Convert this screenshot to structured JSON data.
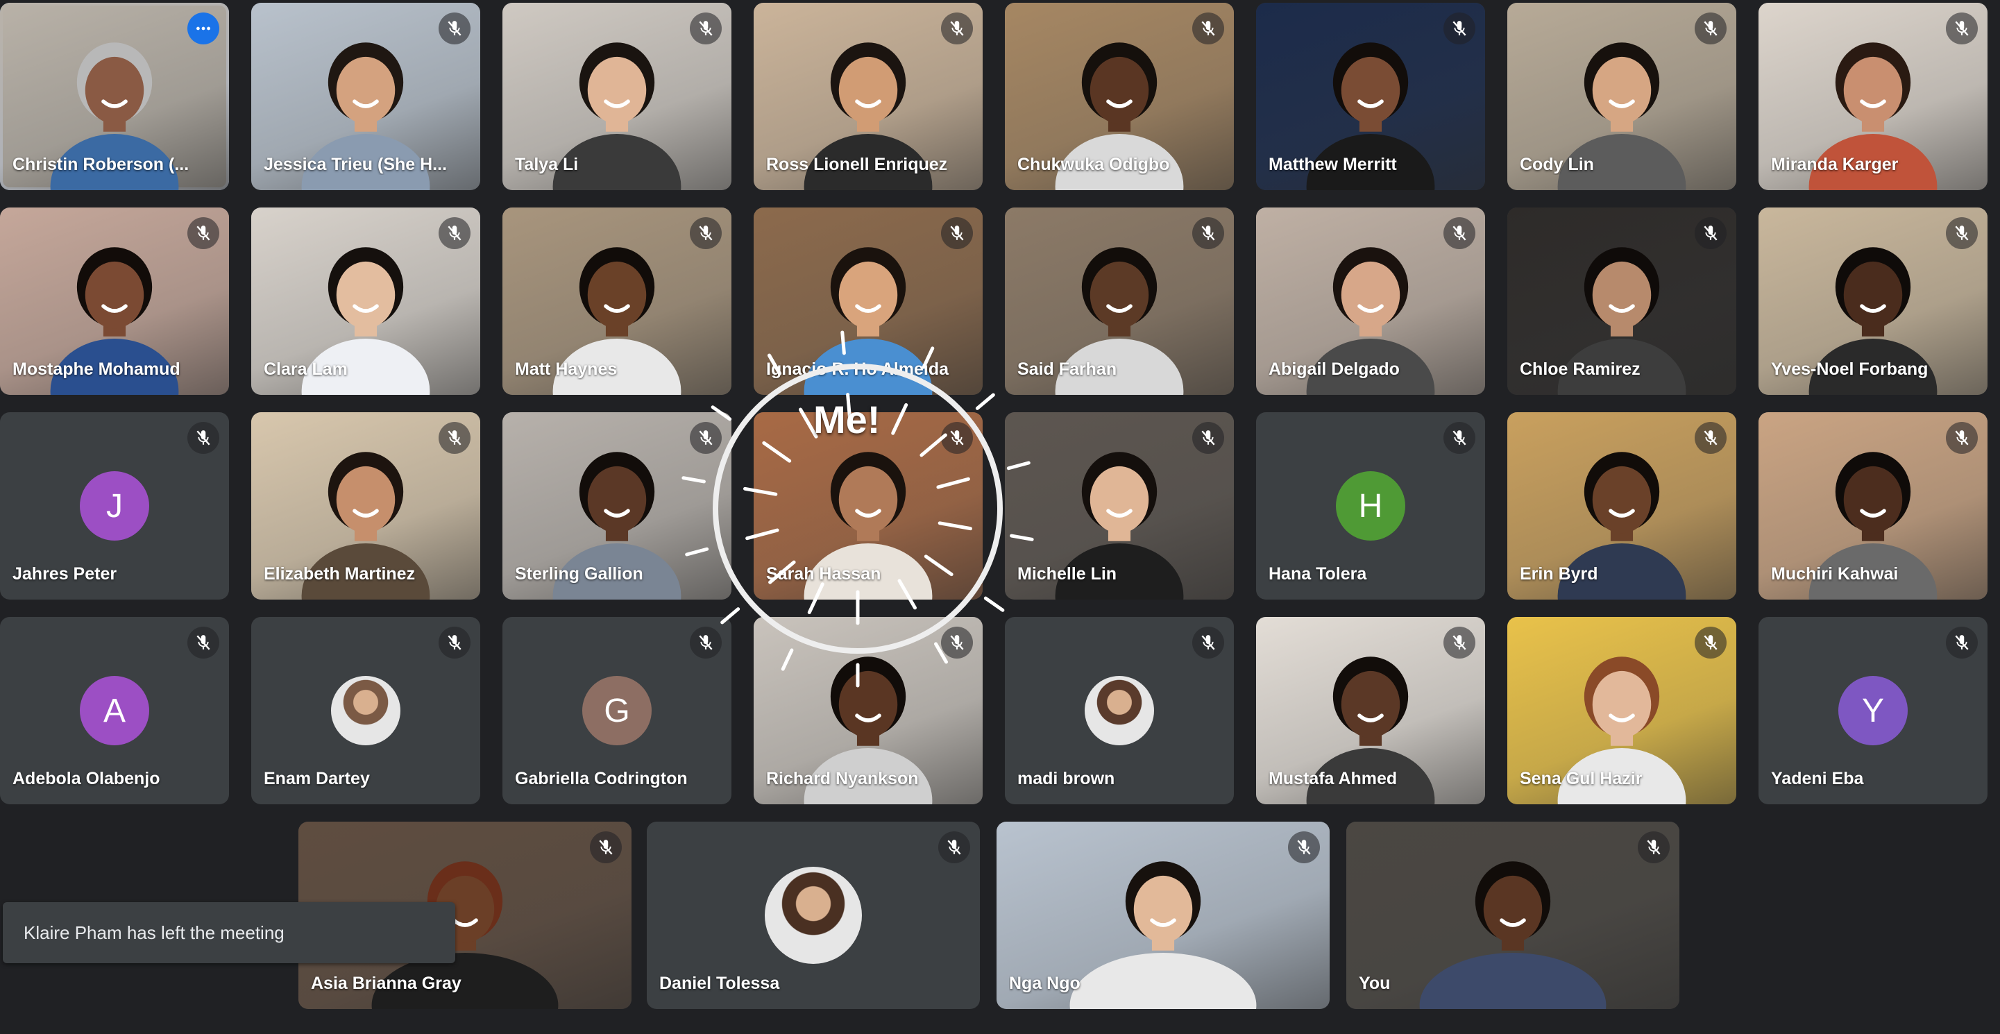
{
  "app": {
    "background": "#202124",
    "accent": "#1a73e8",
    "active_outline": "#8ab4f8"
  },
  "participants": [
    {
      "name": "Christin Roberson (...",
      "kind": "video",
      "bg": "#b9b2a8",
      "skin": "#8a5a44",
      "hair": "#b8b8b8",
      "shirt": "#3b6aa3",
      "muted": false,
      "pinned_menu": true
    },
    {
      "name": "Jessica Trieu (She H...",
      "kind": "video",
      "bg": "#b9c2cc",
      "skin": "#d4a27f",
      "hair": "#1f1712",
      "shirt": "#8a9bb0",
      "muted": true
    },
    {
      "name": "Talya Li",
      "kind": "video",
      "bg": "#cfc9c2",
      "skin": "#e0b596",
      "hair": "#1a1410",
      "shirt": "#3a3a3a",
      "muted": true
    },
    {
      "name": "Ross Lionell Enriquez",
      "kind": "video",
      "bg": "#cbb49a",
      "skin": "#d19c74",
      "hair": "#1b1410",
      "shirt": "#2b2b2b",
      "muted": true
    },
    {
      "name": "Chukwuka Odigbo",
      "kind": "video",
      "bg": "#a68763",
      "skin": "#5a3623",
      "hair": "#15100c",
      "shirt": "#d9d9d9",
      "muted": true
    },
    {
      "name": "Matthew Merritt",
      "kind": "video",
      "bg": "#1c2b4a",
      "skin": "#7a4c34",
      "hair": "#120d0a",
      "shirt": "#1a1a1a",
      "muted": true
    },
    {
      "name": "Cody Lin",
      "kind": "video",
      "bg": "#b7aa97",
      "skin": "#d6a683",
      "hair": "#17110d",
      "shirt": "#5c5c5c",
      "muted": true
    },
    {
      "name": "Miranda Karger",
      "kind": "video",
      "bg": "#ddd5cc",
      "skin": "#c98f70",
      "hair": "#2a1a12",
      "shirt": "#c0533a",
      "muted": true
    },
    {
      "name": "Mostaphe Mohamud",
      "kind": "video",
      "bg": "#c5a79a",
      "skin": "#7b4a33",
      "hair": "#120c09",
      "shirt": "#2a4f8f",
      "muted": true
    },
    {
      "name": "Clara Lam",
      "kind": "video",
      "bg": "#d8d2cb",
      "skin": "#e3bd9f",
      "hair": "#15100d",
      "shirt": "#eef0f4",
      "muted": true
    },
    {
      "name": "Matt Haynes",
      "kind": "video",
      "bg": "#a8957d",
      "skin": "#6a4128",
      "hair": "#110c09",
      "shirt": "#e8e8e8",
      "muted": true
    },
    {
      "name": "Ignacio R. Ho Almeida",
      "kind": "video",
      "bg": "#8c6a4c",
      "skin": "#d9a47c",
      "hair": "#1a120d",
      "shirt": "#4a8fd1",
      "muted": true
    },
    {
      "name": "Said Farhan",
      "kind": "video",
      "bg": "#8c7a67",
      "skin": "#5c3a26",
      "hair": "#120d0a",
      "shirt": "#d8d8d8",
      "muted": true
    },
    {
      "name": "Abigail Delgado",
      "kind": "video",
      "bg": "#bfb0a4",
      "skin": "#d7a789",
      "hair": "#1a120e",
      "shirt": "#4a4a4a",
      "muted": true
    },
    {
      "name": "Chloe Ramirez",
      "kind": "video",
      "bg": "#2e2b29",
      "skin": "#b78a6c",
      "hair": "#0f0b09",
      "shirt": "#3d3d3d",
      "muted": true
    },
    {
      "name": "Yves-Noel Forbang",
      "kind": "video",
      "bg": "#c9b79c",
      "skin": "#4a2c1d",
      "hair": "#0f0b09",
      "shirt": "#2a2a2a",
      "muted": true
    },
    {
      "name": "Jahres Peter",
      "kind": "avatar",
      "initial": "J",
      "avatar_color": "#9c4fc4",
      "muted": true
    },
    {
      "name": "Elizabeth Martinez",
      "kind": "video",
      "bg": "#d8c7ad",
      "skin": "#c68f6c",
      "hair": "#1d140f",
      "shirt": "#5a4a3a",
      "muted": true
    },
    {
      "name": "Sterling Gallion",
      "kind": "video",
      "bg": "#b7b1ab",
      "skin": "#5b3826",
      "hair": "#120d0a",
      "shirt": "#7a8594",
      "muted": true
    },
    {
      "name": "Sarah Hassan",
      "kind": "video",
      "bg": "#a86a45",
      "skin": "#b07a58",
      "hair": "#1a120d",
      "shirt": "#e8e2da",
      "muted": true
    },
    {
      "name": "Michelle Lin",
      "kind": "video",
      "bg": "#5d5650",
      "skin": "#e0b696",
      "hair": "#140f0c",
      "shirt": "#1e1e1e",
      "muted": true
    },
    {
      "name": "Hana Tolera",
      "kind": "avatar",
      "initial": "H",
      "avatar_color": "#4f9a35",
      "muted": true
    },
    {
      "name": "Erin Byrd",
      "kind": "video",
      "bg": "#c9a05e",
      "skin": "#6a4129",
      "hair": "#110c09",
      "shirt": "#2f3a52",
      "muted": true
    },
    {
      "name": "Muchiri Kahwai",
      "kind": "video",
      "bg": "#caa483",
      "skin": "#4c2d1e",
      "hair": "#0f0b09",
      "shirt": "#6a6a6a",
      "muted": true
    },
    {
      "name": "Adebola Olabenjo",
      "kind": "avatar",
      "initial": "A",
      "avatar_color": "#9c4fc4",
      "muted": true
    },
    {
      "name": "Enam Dartey",
      "kind": "photo",
      "avatar_color": "#7b5a45",
      "muted": true
    },
    {
      "name": "Gabriella Codrington",
      "kind": "avatar",
      "initial": "G",
      "avatar_color": "#8d6e63",
      "muted": true
    },
    {
      "name": "Richard Nyankson",
      "kind": "video",
      "bg": "#c9c3bc",
      "skin": "#5a3623",
      "hair": "#110c09",
      "shirt": "#cfcfcf",
      "muted": true
    },
    {
      "name": "madi brown",
      "kind": "photo",
      "avatar_color": "#5a3b2c",
      "muted": true
    },
    {
      "name": "Mustafa Ahmed",
      "kind": "video",
      "bg": "#e3ddd6",
      "skin": "#5b3826",
      "hair": "#120d0a",
      "shirt": "#3a3a3a",
      "muted": true
    },
    {
      "name": "Sena Gul Hazir",
      "kind": "video",
      "bg": "#e9c24a",
      "skin": "#e2b89a",
      "hair": "#8a4a28",
      "shirt": "#e8e8e8",
      "muted": true
    },
    {
      "name": "Yadeni Eba",
      "kind": "avatar",
      "initial": "Y",
      "avatar_color": "#7e57c2",
      "muted": true
    },
    {
      "name": "Asia Brianna Gray",
      "kind": "video",
      "bg": "#5f4d40",
      "skin": "#6b3f27",
      "hair": "#6a2e1a",
      "shirt": "#1e1e1e",
      "muted": true
    },
    {
      "name": "Daniel Tolessa",
      "kind": "photo-big",
      "avatar_color": "#4a3022",
      "muted": true
    },
    {
      "name": "Nga Ngo",
      "kind": "video",
      "bg": "#b9c3cf",
      "skin": "#e2b999",
      "hair": "#17110d",
      "shirt": "#e8e8e8",
      "muted": true
    },
    {
      "name": "You",
      "kind": "video",
      "bg": "#4b4742",
      "skin": "#5a3623",
      "hair": "#110c09",
      "shirt": "#3d4a6a",
      "muted": true
    }
  ],
  "overlay": {
    "me_label": "Me!",
    "highlighted": "Sarah Hassan"
  },
  "notification": {
    "text": "Klaire Pham has left the meeting"
  }
}
